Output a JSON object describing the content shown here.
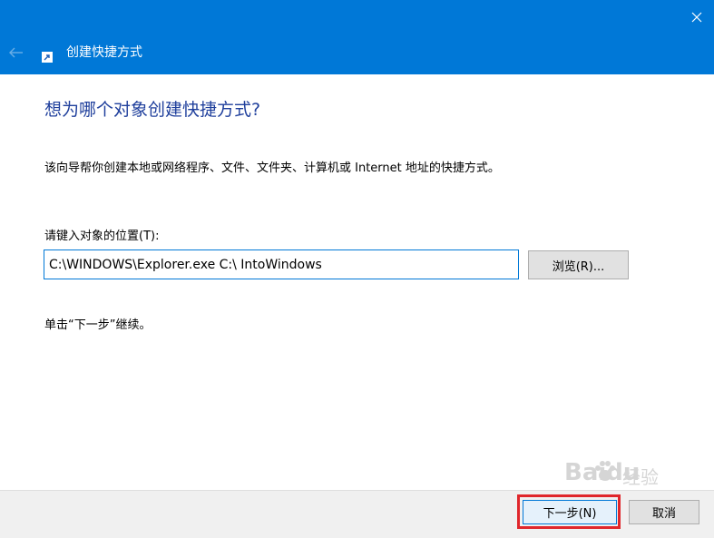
{
  "colors": {
    "titlebar": "#0078d7",
    "heading": "#1f3f9c",
    "highlight": "#e0262b",
    "footer": "#f0f0f0"
  },
  "titlebar": {
    "title": "创建快捷方式",
    "back_icon": "arrow-left-icon",
    "close_icon": "close-icon",
    "app_icon": "shortcut-icon"
  },
  "main": {
    "heading": "想为哪个对象创建快捷方式?",
    "description": "该向导帮你创建本地或网络程序、文件、文件夹、计算机或 Internet 地址的快捷方式。",
    "location_label": "请键入对象的位置(T):",
    "location_value": "C:\\WINDOWS\\Explorer.exe C:\\ IntoWindows",
    "browse_label": "浏览(R)...",
    "hint": "单击“下一步”继续。"
  },
  "footer": {
    "next_label": "下一步(N)",
    "cancel_label": "取消"
  },
  "watermark": {
    "brand": "Baidu",
    "suffix": "经验"
  }
}
